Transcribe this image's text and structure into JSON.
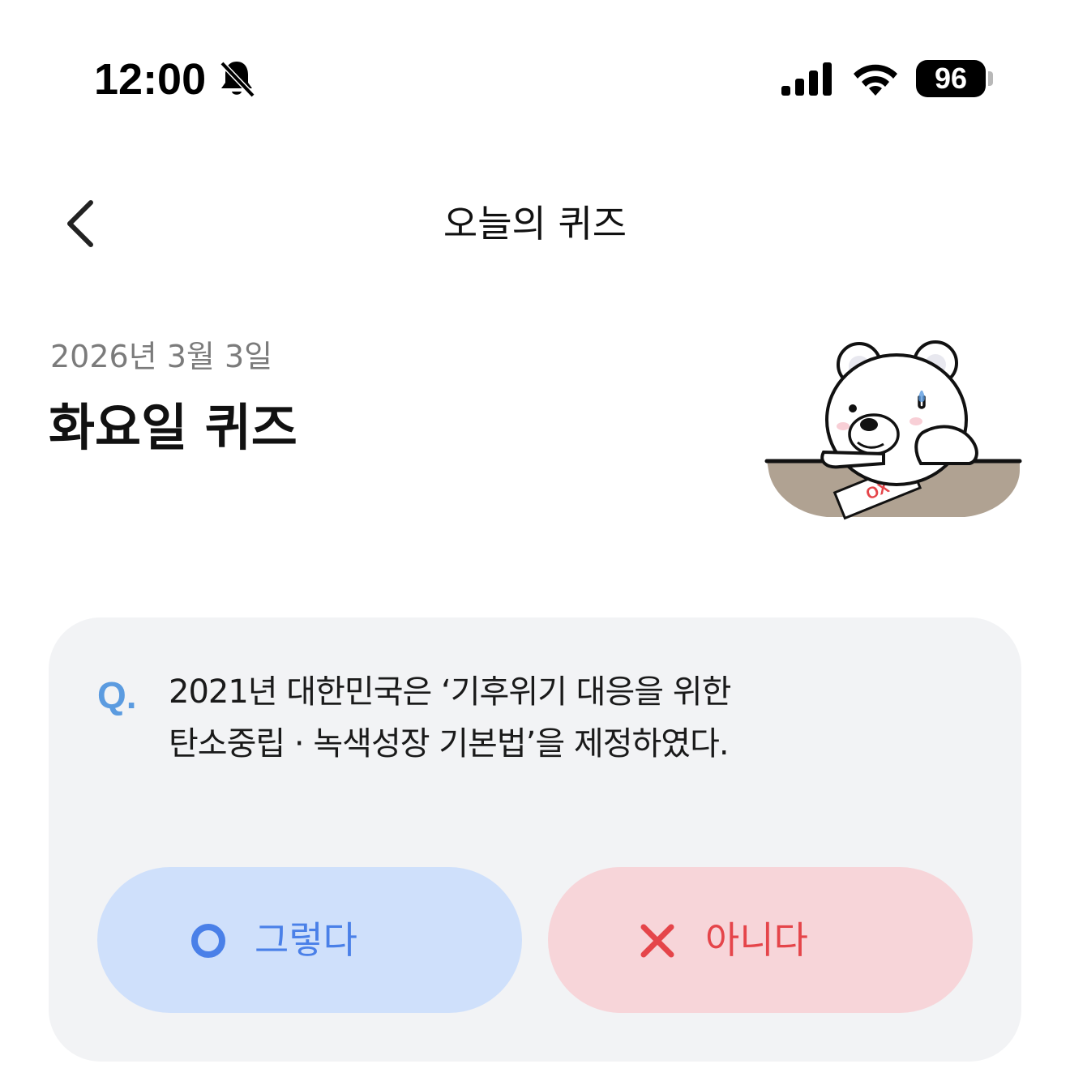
{
  "status_bar": {
    "time": "12:00",
    "battery_level": "96",
    "icons": [
      "bell-off-icon",
      "signal-icon",
      "wifi-icon",
      "battery-icon"
    ]
  },
  "header": {
    "title": "오늘의 퀴즈",
    "back_icon": "chevron-left-icon"
  },
  "quiz": {
    "date": "2026년 3월 3일",
    "title": "화요일 퀴즈",
    "illustration": "bear-with-ox-paper",
    "illustration_text": "OX",
    "question_prefix": "Q.",
    "question_lines": [
      "2021년 대한민국은 ‘기후위기 대응을 위한",
      "탄소중립 · 녹색성장 기본법’을 제정하였다."
    ],
    "answers": {
      "yes_label": "그렇다",
      "no_label": "아니다"
    }
  },
  "colors": {
    "accent_blue": "#4a80e8",
    "accent_red": "#e5454a",
    "yes_bg": "#cfe0fb",
    "no_bg": "#f7d5d9",
    "card_bg": "#f2f3f5"
  }
}
